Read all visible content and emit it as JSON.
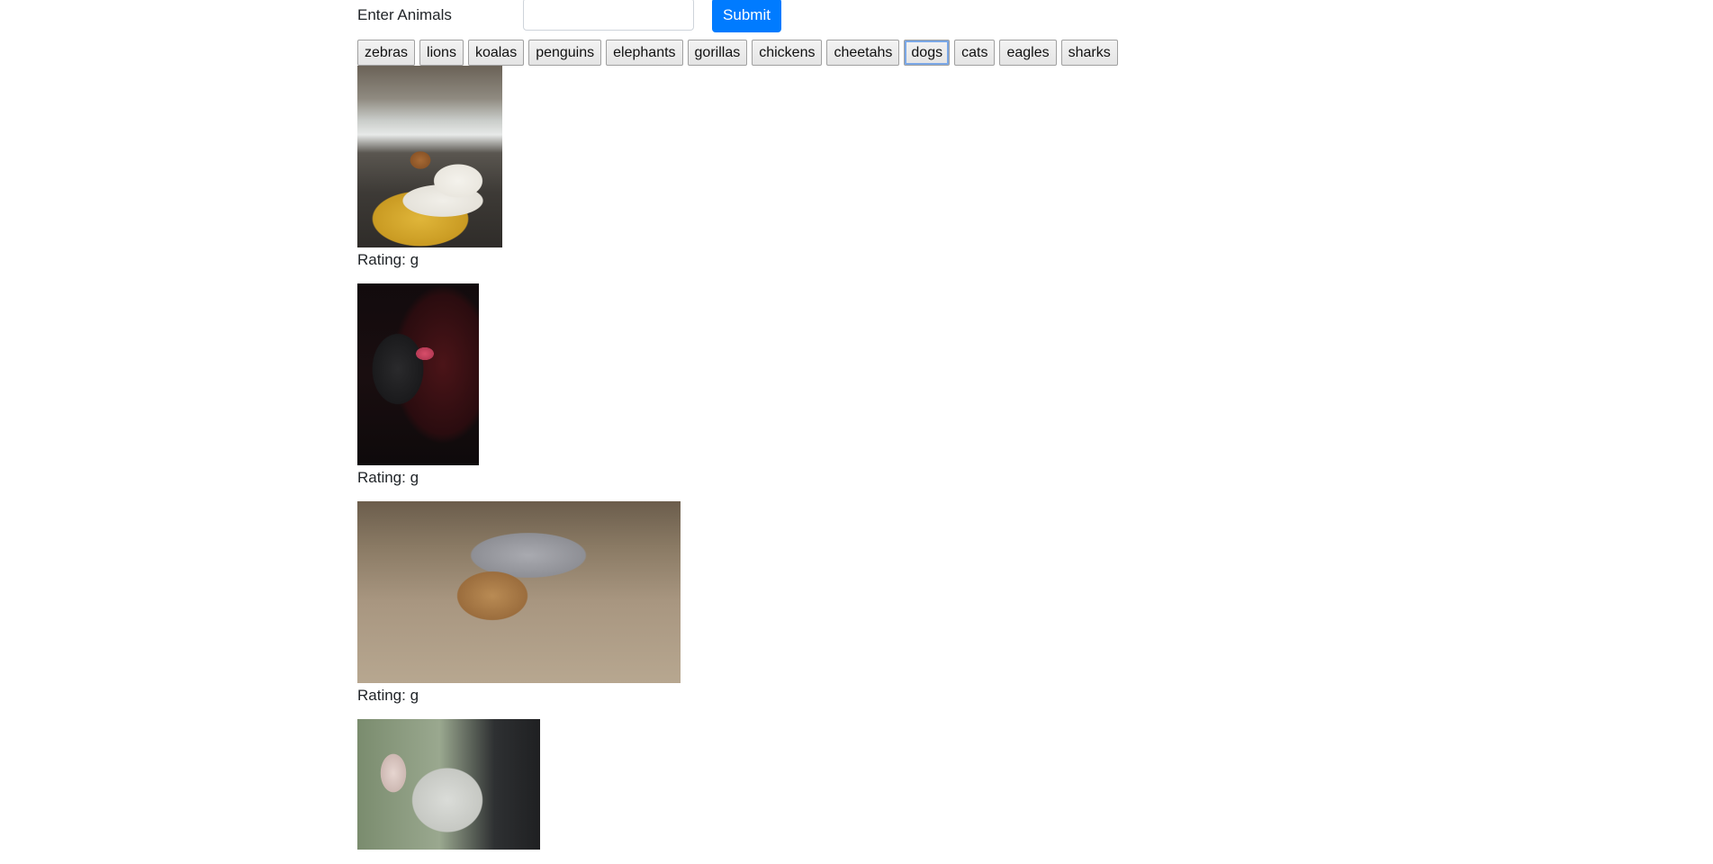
{
  "form": {
    "label": "Enter Animals",
    "input_value": "",
    "input_placeholder": "",
    "submit_label": "Submit"
  },
  "animal_buttons": [
    {
      "label": "zebras"
    },
    {
      "label": "lions"
    },
    {
      "label": "koalas"
    },
    {
      "label": "penguins"
    },
    {
      "label": "elephants"
    },
    {
      "label": "gorillas"
    },
    {
      "label": "chickens"
    },
    {
      "label": "cheetahs"
    },
    {
      "label": "dogs",
      "focused": true
    },
    {
      "label": "cats"
    },
    {
      "label": "eagles"
    },
    {
      "label": "sharks"
    }
  ],
  "gifs": [
    {
      "rating": "Rating: g",
      "alt": "white dog and puppy on yellow blanket"
    },
    {
      "rating": "Rating: g",
      "alt": "dark dog with tongue out"
    },
    {
      "rating": "Rating: g",
      "alt": "pomeranian wrapped in towel on floor"
    },
    {
      "rating": "",
      "alt": "french bulldog in car"
    }
  ],
  "colors": {
    "submit_bg": "#007bff",
    "focus_ring": "#7aa7e6"
  }
}
